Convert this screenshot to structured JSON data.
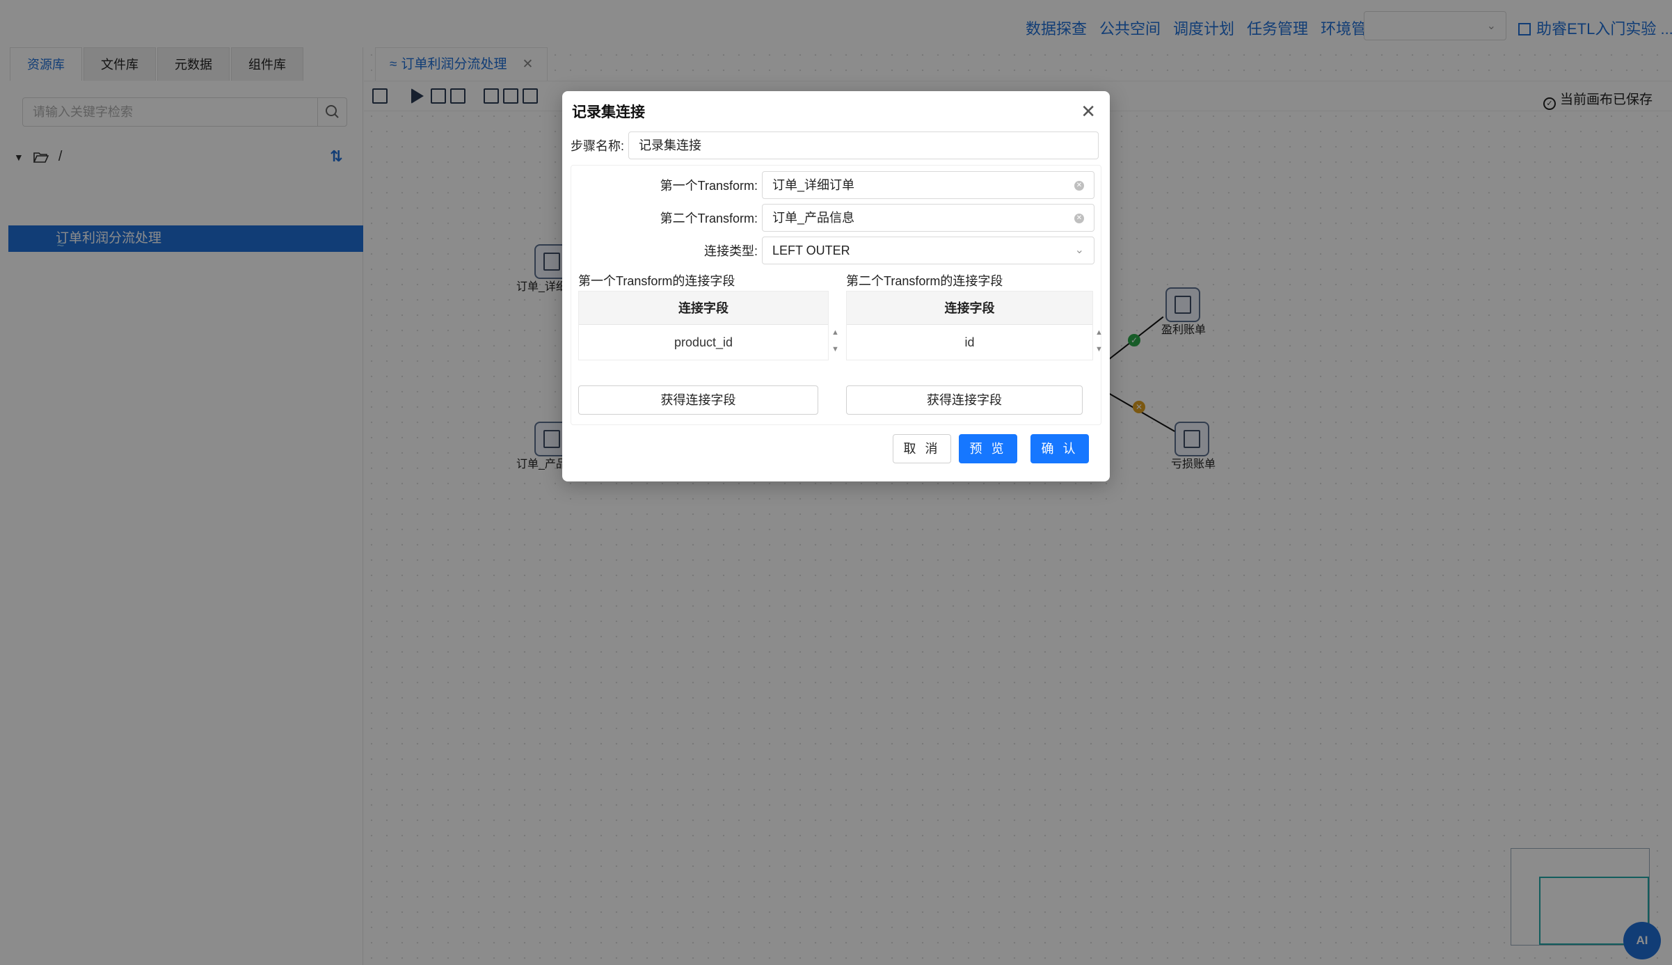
{
  "topnav": {
    "links": [
      "数据探查",
      "公共空间",
      "调度计划",
      "任务管理",
      "环境管理"
    ],
    "env_select_value": "",
    "guide_label": "助睿ETL入门实验 ..."
  },
  "left_panel": {
    "tabs": [
      "资源库",
      "文件库",
      "元数据",
      "组件库"
    ],
    "search_placeholder": "请输入关键字检索",
    "tree_root": "/",
    "tree_item": "订单利润分流处理"
  },
  "canvas": {
    "doc_tab": "订单利润分流处理",
    "saved_status": "当前画布已保存",
    "nodes": {
      "order_detail": "订单_详细",
      "product_info": "订单_产品",
      "profit": "盈利账单",
      "loss": "亏损账单"
    },
    "ai_button": "AI"
  },
  "modal": {
    "title": "记录集连接",
    "step_name_label": "步骤名称:",
    "step_name_value": "记录集连接",
    "first_transform_label": "第一个Transform:",
    "first_transform_value": "订单_详细订单",
    "second_transform_label": "第二个Transform:",
    "second_transform_value": "订单_产品信息",
    "join_type_label": "连接类型:",
    "join_type_value": "LEFT OUTER",
    "left_section_label": "第一个Transform的连接字段",
    "right_section_label": "第二个Transform的连接字段",
    "left_grid": {
      "header": "连接字段",
      "rows": [
        "product_id"
      ]
    },
    "right_grid": {
      "header": "连接字段",
      "rows": [
        "id"
      ]
    },
    "get_fields_left": "获得连接字段",
    "get_fields_right": "获得连接字段",
    "cancel_label": "取 消",
    "preview_label": "预 览",
    "confirm_label": "确 认"
  }
}
